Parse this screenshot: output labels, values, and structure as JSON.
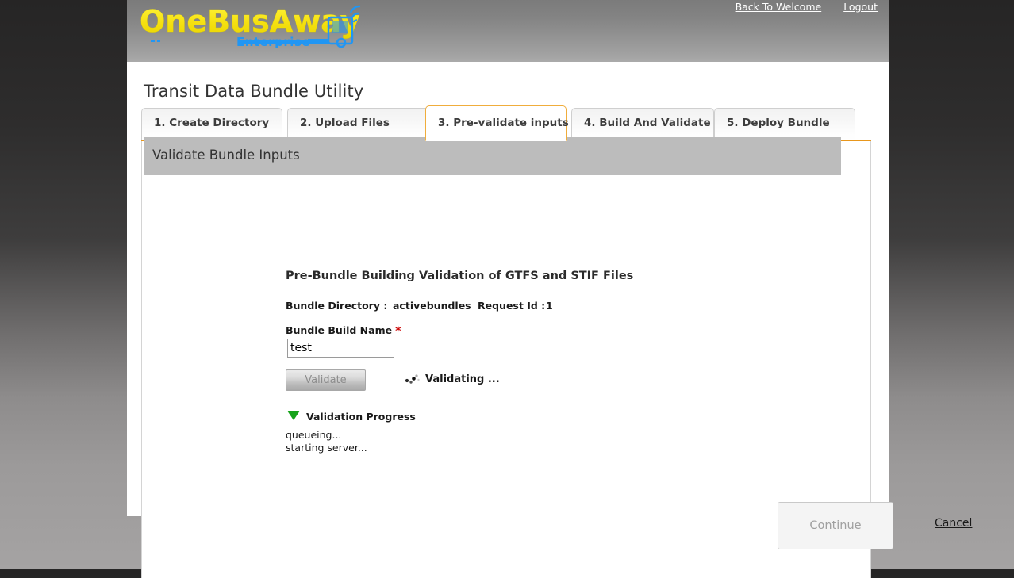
{
  "header": {
    "logo_main": "OneBusAway",
    "logo_sub": "Enterprise",
    "links": [
      {
        "label": "Back To Welcome",
        "name": "back-to-welcome-link"
      },
      {
        "label": "Logout",
        "name": "logout-link"
      }
    ]
  },
  "page": {
    "title": "Transit Data Bundle Utility"
  },
  "tabs": [
    {
      "label": "1. Create Directory",
      "active": false
    },
    {
      "label": "2. Upload Files",
      "active": false
    },
    {
      "label": "3. Pre-validate inputs",
      "active": true
    },
    {
      "label": "4. Build And Validate",
      "active": false
    },
    {
      "label": "5. Deploy Bundle",
      "active": false
    }
  ],
  "panel": {
    "heading": "Validate Bundle Inputs",
    "subtitle": "Pre-Bundle Building Validation of GTFS and STIF Files",
    "bundle_directory_label": "Bundle Directory :",
    "bundle_directory_value": "activebundles",
    "request_id_label": "Request Id :",
    "request_id_value": "1",
    "build_name_label": "Bundle Build Name",
    "required_marker": "*",
    "build_name_value": "test",
    "build_name_placeholder": "",
    "validate_button": "Validate",
    "status_text": "Validating ...",
    "spinner_icon": "loading-spinner-icon",
    "progress_toggle_icon": "triangle-down-icon",
    "progress_title": "Validation Progress",
    "progress_log": [
      "queueing...",
      "starting server..."
    ]
  },
  "footer": {
    "continue_label": "Continue",
    "cancel_label": "Cancel"
  },
  "colors": {
    "accent_orange": "#e8971d",
    "tab_active_border": "#f0ad3c",
    "logo_yellow": "#f5e010",
    "logo_blue": "#2196f3",
    "required_red": "#cc0000",
    "progress_green": "#16a31a",
    "panel_heading_grey": "#bcbcbc"
  }
}
